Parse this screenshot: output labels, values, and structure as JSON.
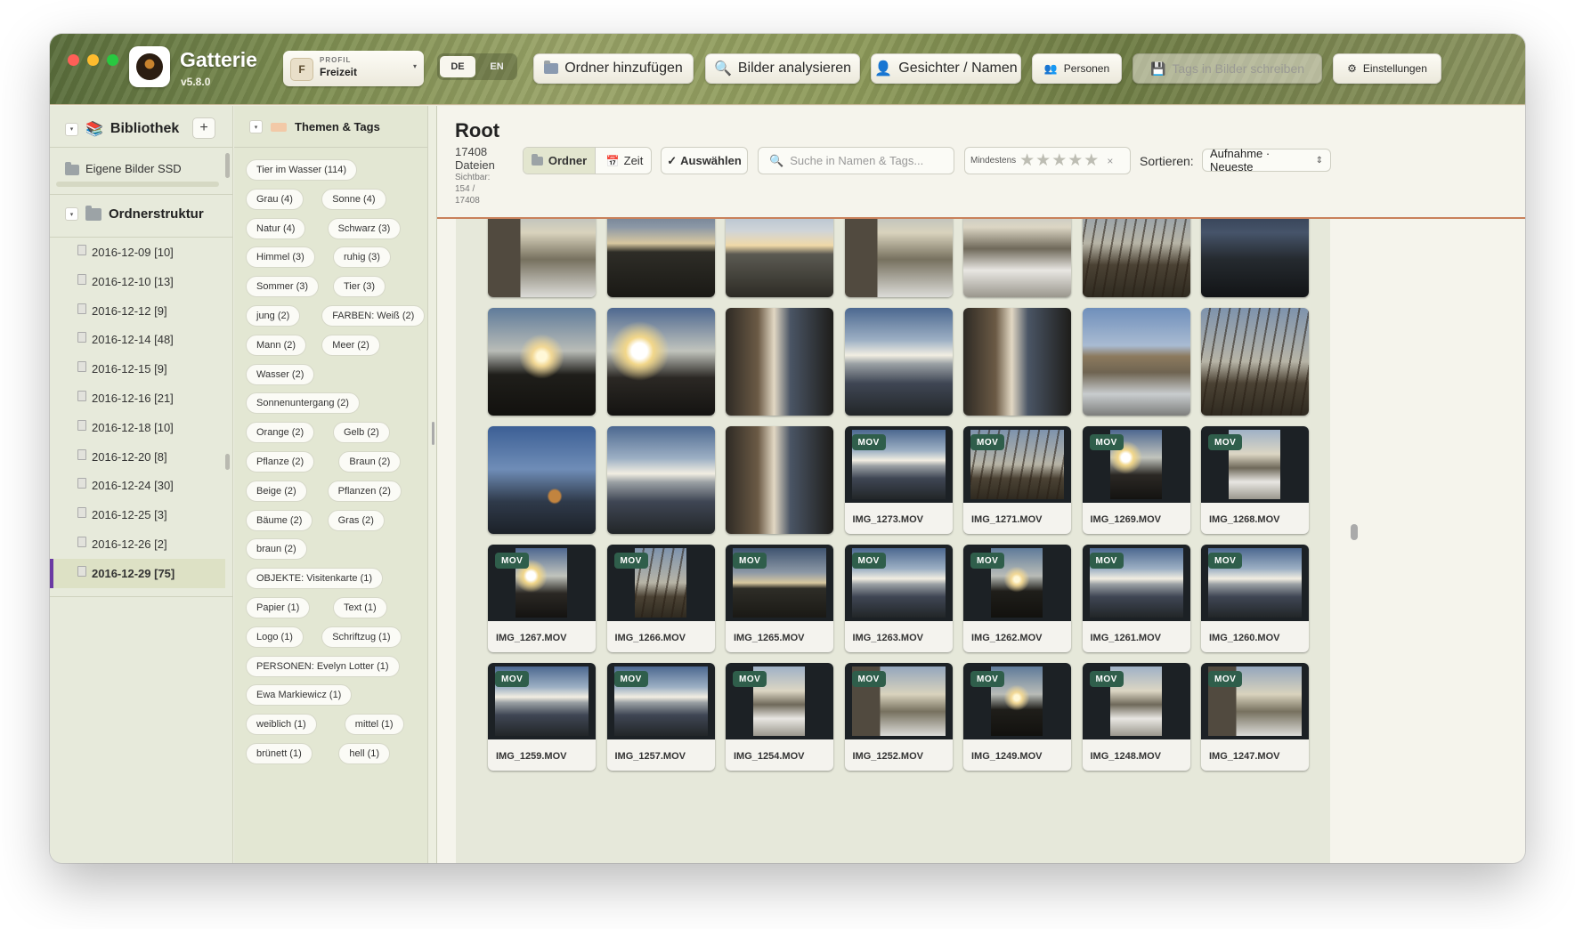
{
  "app": {
    "name": "Gatterie",
    "version": "v5.8.0"
  },
  "profile": {
    "initial": "F",
    "label": "PROFIL",
    "value": "Freizeit"
  },
  "language": {
    "de": "DE",
    "en": "EN"
  },
  "toolbar": {
    "add_folder": "Ordner hinzufügen",
    "analyze": "Bilder analysieren",
    "faces": "Gesichter / Namen",
    "persons": "Personen",
    "write_tags": "Tags in Bilder schreiben",
    "settings": "Einstellungen"
  },
  "sidebar": {
    "library_title": "Bibliothek",
    "add": "+",
    "library_item": "Eigene Bilder SSD",
    "folders_title": "Ordnerstruktur",
    "folders": [
      {
        "label": "2016-12-09 [10]"
      },
      {
        "label": "2016-12-10 [13]"
      },
      {
        "label": "2016-12-12 [9]"
      },
      {
        "label": "2016-12-14 [48]"
      },
      {
        "label": "2016-12-15 [9]"
      },
      {
        "label": "2016-12-16 [21]"
      },
      {
        "label": "2016-12-18 [10]"
      },
      {
        "label": "2016-12-20 [8]"
      },
      {
        "label": "2016-12-24 [30]"
      },
      {
        "label": "2016-12-25 [3]"
      },
      {
        "label": "2016-12-26 [2]"
      },
      {
        "label": "2016-12-29 [75]",
        "selected": true
      }
    ]
  },
  "tags": {
    "title": "Themen & Tags",
    "rows": [
      [
        "Tier im Wasser (114)"
      ],
      [
        "Grau (4)",
        "Sonne (4)"
      ],
      [
        "Natur (4)",
        "Schwarz (3)"
      ],
      [
        "Himmel (3)",
        "ruhig (3)"
      ],
      [
        "Sommer (3)",
        "Tier (3)"
      ],
      [
        "jung (2)",
        "FARBEN: Weiß (2)"
      ],
      [
        "Mann (2)",
        "Meer (2)"
      ],
      [
        "Wasser (2)"
      ],
      [
        "Sonnenuntergang (2)"
      ],
      [
        "Orange (2)",
        "Gelb (2)"
      ],
      [
        "Pflanze (2)",
        "Braun (2)"
      ],
      [
        "Beige (2)",
        "Pflanzen (2)"
      ],
      [
        "Bäume (2)",
        "Gras (2)"
      ],
      [
        "braun (2)"
      ],
      [
        "OBJEKTE: Visitenkarte (1)"
      ],
      [
        "Papier (1)",
        "Text (1)"
      ],
      [
        "Logo (1)",
        "Schriftzug (1)"
      ],
      [
        "PERSONEN: Evelyn Lotter (1)"
      ],
      [
        "Ewa Markiewicz (1)"
      ],
      [
        "weiblich (1)",
        "mittel (1)"
      ],
      [
        "brünett (1)",
        "hell (1)"
      ]
    ]
  },
  "main": {
    "title": "Root",
    "file_count": "17408 Dateien",
    "visible": "Sichtbar: 154 / 17408",
    "view": {
      "folder": "Ordner",
      "time": "Zeit"
    },
    "select": "Auswählen",
    "search_placeholder": "Suche in Namen & Tags...",
    "rating_label": "Mindestens",
    "rating_stars": "★★★★★",
    "rating_clear": "×",
    "sort_label": "Sortieren:",
    "sort_value": "Aufnahme · Neueste",
    "badge": "MOV",
    "rows": [
      [
        {
          "s": "a"
        },
        {
          "s": "b"
        },
        {
          "s": "c"
        },
        {
          "s": "d"
        },
        {
          "s": "e"
        },
        {
          "s": "f"
        },
        {
          "s": "g"
        }
      ],
      [
        {
          "s": "h"
        },
        {
          "s": "i"
        },
        {
          "s": "j"
        },
        {
          "s": "k"
        },
        {
          "s": "l"
        },
        {
          "s": "m"
        },
        {
          "s": "n"
        }
      ],
      [
        {
          "s": "o"
        },
        {
          "s": "p"
        },
        {
          "s": "q"
        },
        {
          "s": "r",
          "name": "IMG_1273.MOV"
        },
        {
          "s": "s",
          "name": "IMG_1271.MOV"
        },
        {
          "s": "t",
          "name": "IMG_1269.MOV"
        },
        {
          "s": "u",
          "name": "IMG_1268.MOV"
        }
      ],
      [
        {
          "s": "v",
          "name": "IMG_1267.MOV"
        },
        {
          "s": "w",
          "name": "IMG_1266.MOV"
        },
        {
          "s": "x",
          "name": "IMG_1265.MOV"
        },
        {
          "s": "r",
          "name": "IMG_1263.MOV"
        },
        {
          "s": "y",
          "name": "IMG_1262.MOV"
        },
        {
          "s": "z",
          "name": "IMG_1261.MOV"
        },
        {
          "s": "aa",
          "name": "IMG_1260.MOV"
        }
      ],
      [
        {
          "s": "bb",
          "name": "IMG_1259.MOV"
        },
        {
          "s": "p",
          "name": "IMG_1257.MOV"
        },
        {
          "s": "cc",
          "name": "IMG_1254.MOV"
        },
        {
          "s": "dd",
          "name": "IMG_1252.MOV"
        },
        {
          "s": "ee",
          "name": "IMG_1249.MOV"
        },
        {
          "s": "ff",
          "name": "IMG_1248.MOV"
        },
        {
          "s": "gg",
          "name": "IMG_1247.MOV"
        }
      ]
    ]
  }
}
